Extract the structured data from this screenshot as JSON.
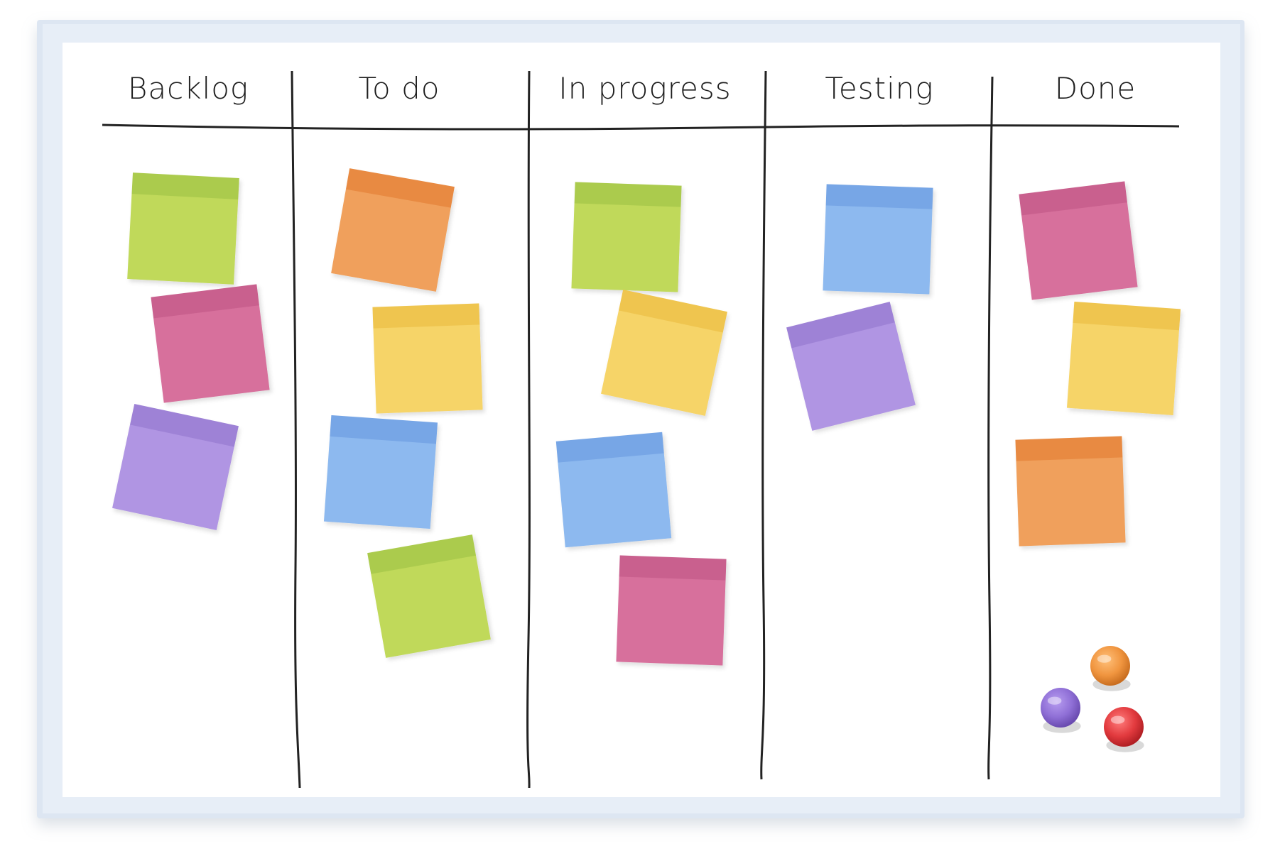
{
  "board": {
    "frame_color": "#dbe5f1",
    "surface_color": "#ffffff",
    "columns": [
      {
        "title": "Backlog",
        "notes": [
          "green",
          "pink",
          "purple"
        ]
      },
      {
        "title": "To do",
        "notes": [
          "orange",
          "yellow",
          "blue",
          "green"
        ]
      },
      {
        "title": "In progress",
        "notes": [
          "green",
          "yellow",
          "blue",
          "pink"
        ]
      },
      {
        "title": "Testing",
        "notes": [
          "blue",
          "purple"
        ]
      },
      {
        "title": "Done",
        "notes": [
          "pink",
          "yellow",
          "orange"
        ]
      }
    ],
    "magnets": [
      "orange",
      "purple",
      "red"
    ]
  },
  "palette": {
    "green": {
      "body": "#c0d95a",
      "band": "#abcb4e"
    },
    "pink": {
      "body": "#d76f9c",
      "band": "#c9618e"
    },
    "purple": {
      "body": "#b095e3",
      "band": "#9e82d6"
    },
    "orange": {
      "body": "#f0a05b",
      "band": "#e88a43"
    },
    "yellow": {
      "body": "#f6d468",
      "band": "#efc54f"
    },
    "blue": {
      "body": "#8db9ef",
      "band": "#77a6e6"
    },
    "red": {
      "body": "#e63b3f",
      "band": "#c82c30"
    }
  }
}
